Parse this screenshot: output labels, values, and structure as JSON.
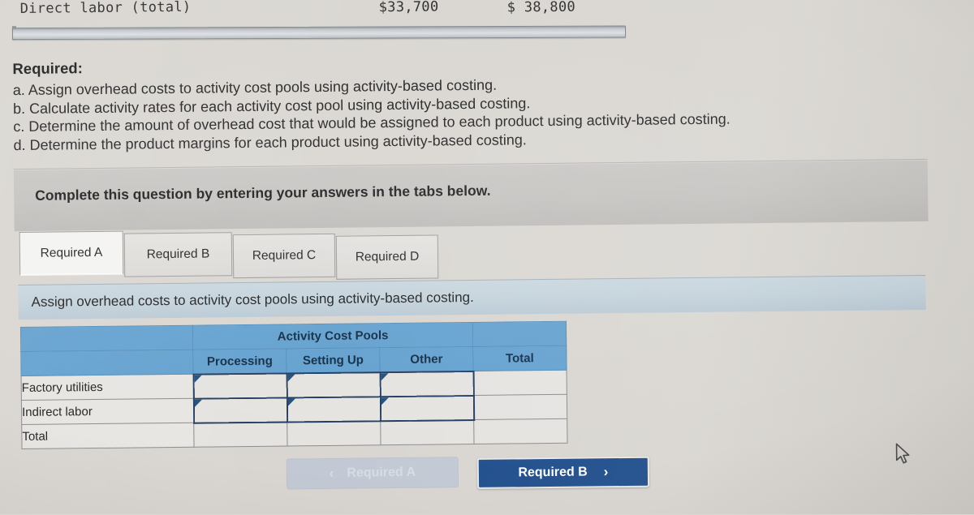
{
  "top_fragment": {
    "label": "Direct labor (total)",
    "value_1": "$33,700",
    "value_2": "$ 38,800"
  },
  "required_section": {
    "heading": "Required:",
    "items": [
      "a. Assign overhead costs to activity cost pools using activity-based costing.",
      "b. Calculate activity rates for each activity cost pool using activity-based costing.",
      "c. Determine the amount of overhead cost that would be assigned to each product using activity-based costing.",
      "d. Determine the product margins for each product using activity-based costing."
    ]
  },
  "complete_banner": {
    "text": "Complete this question by entering your answers in the tabs below."
  },
  "tabs": [
    {
      "label": "Required A",
      "active": true
    },
    {
      "label": "Required B",
      "active": false
    },
    {
      "label": "Required C",
      "active": false
    },
    {
      "label": "Required D",
      "active": false
    }
  ],
  "assign_banner": {
    "text": "Assign overhead costs to activity cost pools using activity-based costing."
  },
  "table": {
    "group_header": "Activity Cost Pools",
    "columns": [
      "Processing",
      "Setting Up",
      "Other"
    ],
    "total_column": "Total",
    "rows": [
      {
        "label": "Factory utilities",
        "processing": "",
        "setting_up": "",
        "other": "",
        "total": ""
      },
      {
        "label": "Indirect labor",
        "processing": "",
        "setting_up": "",
        "other": "",
        "total": ""
      },
      {
        "label": "Total",
        "processing": "",
        "setting_up": "",
        "other": "",
        "total": ""
      }
    ]
  },
  "nav": {
    "prev_label": "Required A",
    "prev_chevron": "‹",
    "prev_disabled": true,
    "next_label": "Required B",
    "next_chevron": "›"
  },
  "colors": {
    "table_header_blue": "#62a0cf",
    "input_border_navy": "#1f3a5f",
    "next_button_blue": "#1f4e8c",
    "prev_button_grey": "#c2c9d4",
    "assign_banner_blue": "#c3d2db",
    "complete_banner_grey": "#c4c2bf",
    "page_background": "#d9d6d1"
  }
}
